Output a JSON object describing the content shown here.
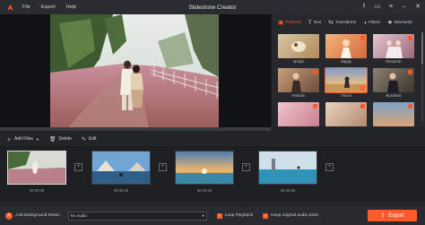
{
  "window": {
    "title": "Slideshow Creator",
    "menu": [
      "File",
      "Export",
      "Help"
    ],
    "controls": [
      "facebook-icon",
      "chat-icon",
      "menu-icon",
      "minimize-icon",
      "close-icon"
    ]
  },
  "tabs": [
    {
      "label": "Themes",
      "icon": "themes-icon",
      "active": true
    },
    {
      "label": "Text",
      "icon": "text-icon",
      "active": false
    },
    {
      "label": "Transitions",
      "icon": "transitions-icon",
      "active": false
    },
    {
      "label": "Filters",
      "icon": "filters-icon",
      "active": false
    },
    {
      "label": "Elements",
      "icon": "elements-icon",
      "active": false
    }
  ],
  "themes": [
    {
      "label": "Simple"
    },
    {
      "label": "Happy"
    },
    {
      "label": "Romantic"
    },
    {
      "label": "Fashion"
    },
    {
      "label": "Travel",
      "selected": true
    },
    {
      "label": "Business"
    },
    {
      "label": ""
    },
    {
      "label": ""
    },
    {
      "label": ""
    }
  ],
  "toolbar": {
    "add_files": "Add Files",
    "delete": "Delete",
    "edit": "Edit"
  },
  "timeline": {
    "clips": [
      {
        "duration": "00:00:05"
      },
      {
        "duration": "00:00:05"
      },
      {
        "duration": "00:00:05"
      },
      {
        "duration": "00:00:05"
      }
    ]
  },
  "bottom": {
    "add_music_label": "Add Background Music:",
    "audio_value": "No Audio",
    "loop_playback": "Loop Playback",
    "keep_audio": "Keep original audio track",
    "export_label": "Export"
  },
  "colors": {
    "accent": "#ff5a2a",
    "background": "#232428"
  }
}
